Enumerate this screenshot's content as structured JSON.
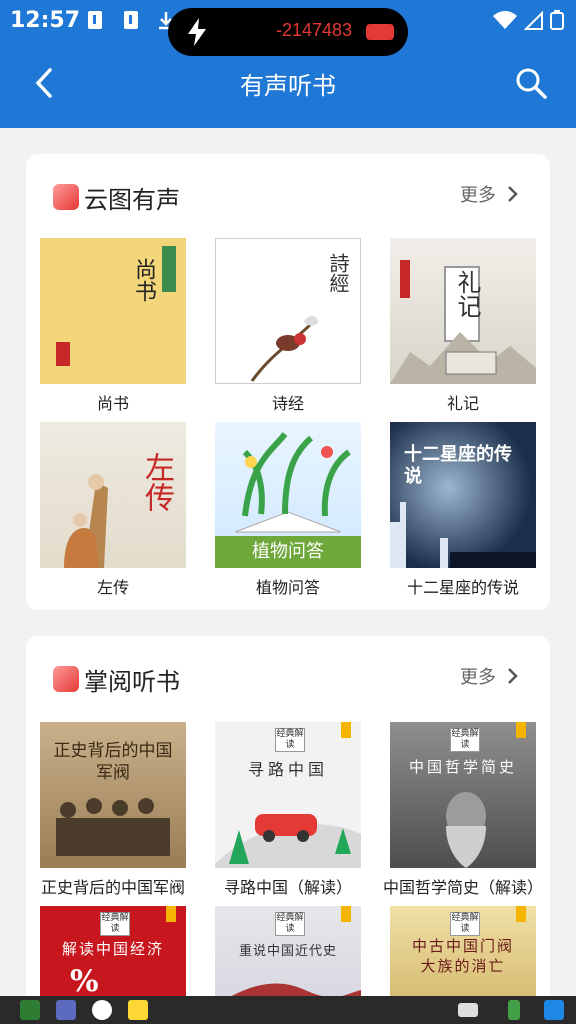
{
  "status": {
    "time": "12:57"
  },
  "overlay": {
    "counter": "-2147483"
  },
  "header": {
    "title": "有声听书"
  },
  "sections": [
    {
      "title": "云图有声",
      "more": "更多",
      "items": [
        {
          "label": "尚书",
          "cover_text": "尚书"
        },
        {
          "label": "诗经",
          "cover_text": "詩經"
        },
        {
          "label": "礼记",
          "cover_text": "礼记"
        },
        {
          "label": "左传",
          "cover_text": "左传"
        },
        {
          "label": "植物问答",
          "cover_text": "植物问答"
        },
        {
          "label": "十二星座的传说",
          "cover_text": "十二星座的传说"
        }
      ]
    },
    {
      "title": "掌阅听书",
      "more": "更多",
      "items": [
        {
          "label": "正史背后的中国军阀",
          "cover_text": "正史背后的中国军阀"
        },
        {
          "label": "寻路中国（解读）",
          "cover_text": "寻路中国",
          "tag": "经典解读"
        },
        {
          "label": "中国哲学简史（解读）",
          "cover_text": "中国哲学简史",
          "tag": "经典解读"
        },
        {
          "label": "",
          "cover_text": "解读中国经济",
          "tag": "经典解读"
        },
        {
          "label": "",
          "cover_text": "重说中国近代史",
          "tag": "经典解读"
        },
        {
          "label": "",
          "cover_text": "中古中国门阀大族的消亡",
          "tag": "经典解读"
        }
      ]
    }
  ],
  "colors": {
    "header_bg": "#1f77d6",
    "page_bg": "#f2f2f2",
    "accent_badge": "#e53935"
  }
}
